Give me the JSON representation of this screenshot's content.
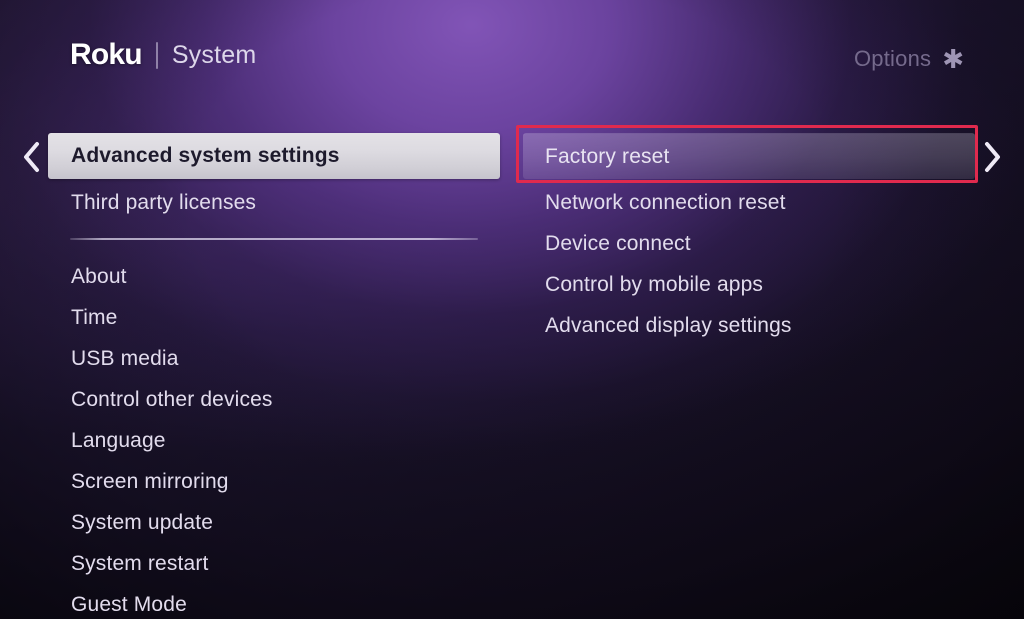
{
  "header": {
    "brand": "Roku",
    "section": "System",
    "options_label": "Options",
    "options_icon": "asterisk-icon"
  },
  "nav": {
    "left_arrow_icon": "chevron-left-icon",
    "right_arrow_icon": "chevron-right-icon"
  },
  "left_column": {
    "selected": "Advanced system settings",
    "items_top": [
      {
        "label": "Third party licenses"
      }
    ],
    "items": [
      {
        "label": "About"
      },
      {
        "label": "Time"
      },
      {
        "label": "USB media"
      },
      {
        "label": "Control other devices"
      },
      {
        "label": "Language"
      },
      {
        "label": "Screen mirroring"
      },
      {
        "label": "System update"
      },
      {
        "label": "System restart"
      },
      {
        "label": "Guest Mode"
      }
    ]
  },
  "right_column": {
    "selected": "Factory reset",
    "items": [
      {
        "label": "Network connection reset"
      },
      {
        "label": "Device connect"
      },
      {
        "label": "Control by mobile apps"
      },
      {
        "label": "Advanced display settings"
      }
    ]
  },
  "annotation": {
    "target": "Factory reset",
    "color": "#e02a4e"
  },
  "colors": {
    "accent_purple": "#6b4299",
    "background_dark": "#100c18",
    "selected_plate": "#dddbe1",
    "text_primary": "#e2dced",
    "text_dim": "#756a8c"
  }
}
